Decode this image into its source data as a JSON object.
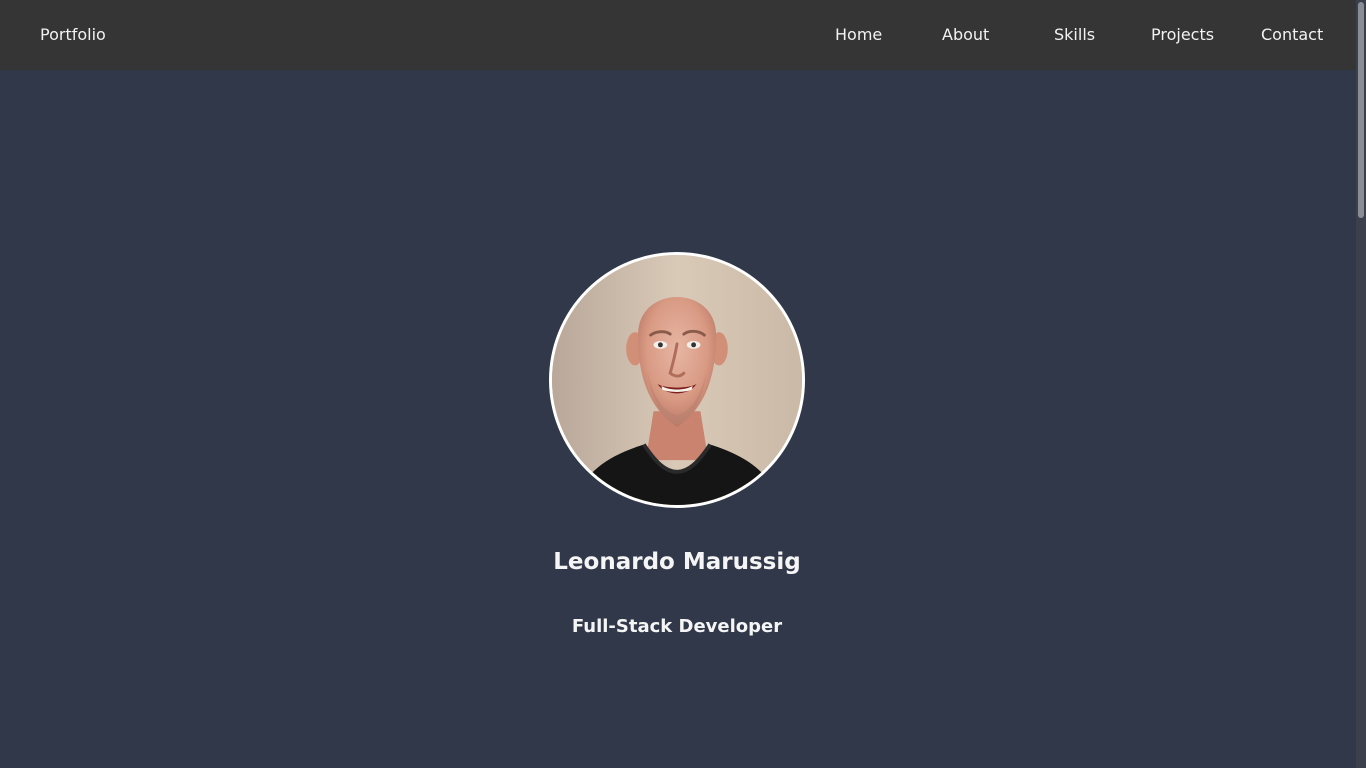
{
  "header": {
    "brand": "Portfolio",
    "nav": {
      "home": "Home",
      "about": "About",
      "skills": "Skills",
      "projects": "Projects",
      "contact": "Contact"
    }
  },
  "hero": {
    "name": "Leonardo Marussig",
    "role": "Full-Stack Developer"
  },
  "colors": {
    "header_background": "#353535",
    "page_background": "#313849",
    "text": "#f2f2f2"
  }
}
